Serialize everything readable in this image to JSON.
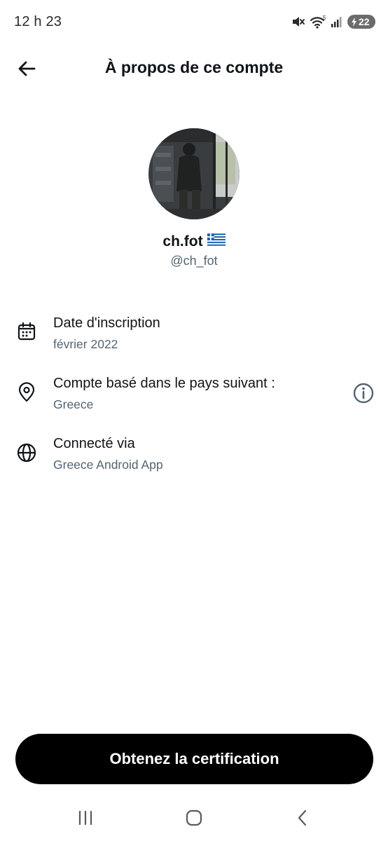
{
  "status_bar": {
    "time": "12 h 23",
    "battery_level": "22",
    "icons": [
      "mute-icon",
      "wifi-icon",
      "signal-icon",
      "battery-icon"
    ]
  },
  "header": {
    "title": "À propos de ce compte",
    "back_icon": "arrow-left-icon"
  },
  "profile": {
    "display_name": "ch.fot",
    "flag_icon": "greek-flag-icon",
    "handle": "@ch_fot"
  },
  "info_items": [
    {
      "icon": "calendar-icon",
      "label": "Date d'inscription",
      "value": "février 2022"
    },
    {
      "icon": "location-pin-icon",
      "label": "Compte basé dans le pays suivant :",
      "value": "Greece",
      "action_icon": "info-icon"
    },
    {
      "icon": "globe-icon",
      "label": "Connecté via",
      "value": "Greece Android App"
    }
  ],
  "cta": {
    "label": "Obtenez la certification"
  },
  "nav_bar": {
    "buttons": [
      "recents-icon",
      "home-icon",
      "back-nav-icon"
    ]
  },
  "colors": {
    "text_primary": "#0f1419",
    "text_secondary": "#536471",
    "button_bg": "#000000",
    "background": "#ffffff"
  }
}
